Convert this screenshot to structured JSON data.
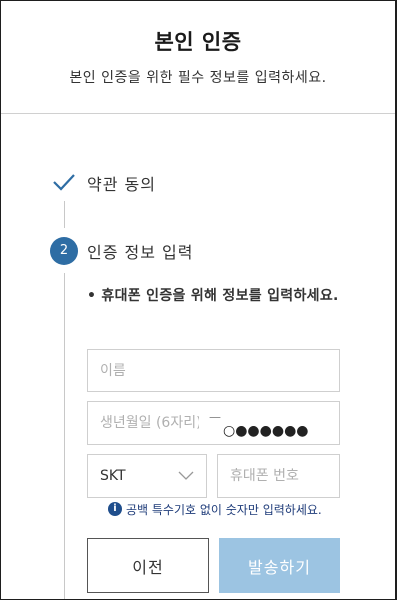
{
  "header": {
    "title": "본인 인증",
    "subtitle": "본인 인증을 위한 필수 정보를 입력하세요."
  },
  "steps": {
    "step1": {
      "label": "약관 동의",
      "status": "completed",
      "icon": "check-icon"
    },
    "step2": {
      "number": "2",
      "label": "인증 정보 입력",
      "status": "active"
    }
  },
  "form": {
    "instruction": "• 휴대폰 인증을 위해 정보를 입력하세요.",
    "name_placeholder": "이름",
    "birth_placeholder": "생년월일 (6자리)",
    "birth_dash": "—",
    "mask_dots": "○●●●●●●",
    "carrier_value": "SKT",
    "phone_placeholder": "휴대폰 번호",
    "info_icon": "i",
    "info_text": "공백 특수기호 없이 숫자만 입력하세요."
  },
  "buttons": {
    "prev_label": "이전",
    "send_label": "발송하기"
  },
  "colors": {
    "accent": "#2e6da4",
    "info": "#1f4e8c",
    "send_button_disabled": "#9cc4e2"
  }
}
